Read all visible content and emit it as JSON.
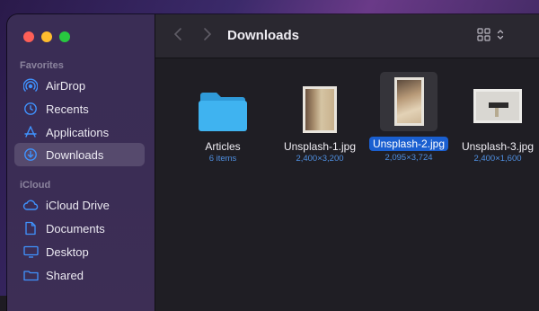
{
  "window": {
    "title": "Downloads"
  },
  "sidebar": {
    "sections": [
      {
        "title": "Favorites",
        "items": [
          {
            "label": "AirDrop",
            "icon": "airdrop-icon"
          },
          {
            "label": "Recents",
            "icon": "clock-icon"
          },
          {
            "label": "Applications",
            "icon": "applications-icon"
          },
          {
            "label": "Downloads",
            "icon": "download-icon",
            "selected": true
          }
        ]
      },
      {
        "title": "iCloud",
        "items": [
          {
            "label": "iCloud Drive",
            "icon": "cloud-icon"
          },
          {
            "label": "Documents",
            "icon": "document-icon"
          },
          {
            "label": "Desktop",
            "icon": "desktop-icon"
          },
          {
            "label": "Shared",
            "icon": "shared-folder-icon"
          }
        ]
      }
    ]
  },
  "files": [
    {
      "name": "Articles",
      "meta": "6 items",
      "kind": "folder"
    },
    {
      "name": "Unsplash-1.jpg",
      "meta": "2,400×3,200",
      "kind": "image"
    },
    {
      "name": "Unsplash-2.jpg",
      "meta": "2,095×3,724",
      "kind": "image",
      "selected": true
    },
    {
      "name": "Unsplash-3.jpg",
      "meta": "2,400×1,600",
      "kind": "image"
    }
  ],
  "colors": {
    "accent": "#1a5fd0",
    "folder": "#3fb3f0",
    "meta_text": "#4f8fe0"
  }
}
